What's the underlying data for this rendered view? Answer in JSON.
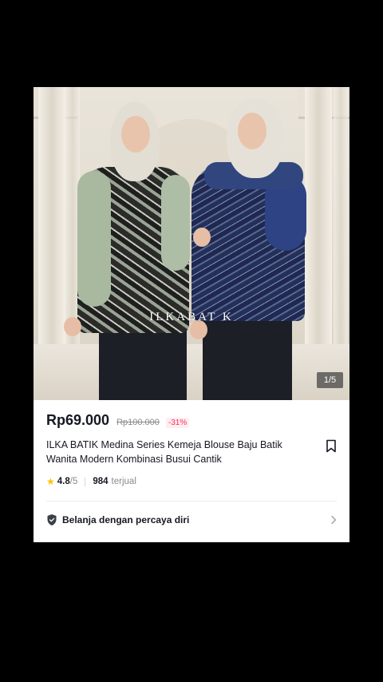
{
  "product": {
    "image": {
      "watermark": "ILKABAT K",
      "counter": "1/5"
    },
    "price": "Rp69.000",
    "original_price": "Rp100.000",
    "discount": "-31%",
    "title": "ILKA BATIK Medina Series Kemeja Blouse Baju Batik Wanita Modern Kombinasi Busui Cantik",
    "rating": "4.8",
    "rating_max": "/5",
    "sold_count": "984",
    "sold_label": "terjual"
  },
  "trust_banner": {
    "label": "Belanja dengan percaya diri"
  },
  "colors": {
    "price": "#161823",
    "discount": "#fe2c55",
    "star": "#ffc300",
    "background": "#000000"
  },
  "icons": [
    "bookmark-icon",
    "star-icon",
    "shield-icon",
    "chevron-right-icon"
  ]
}
